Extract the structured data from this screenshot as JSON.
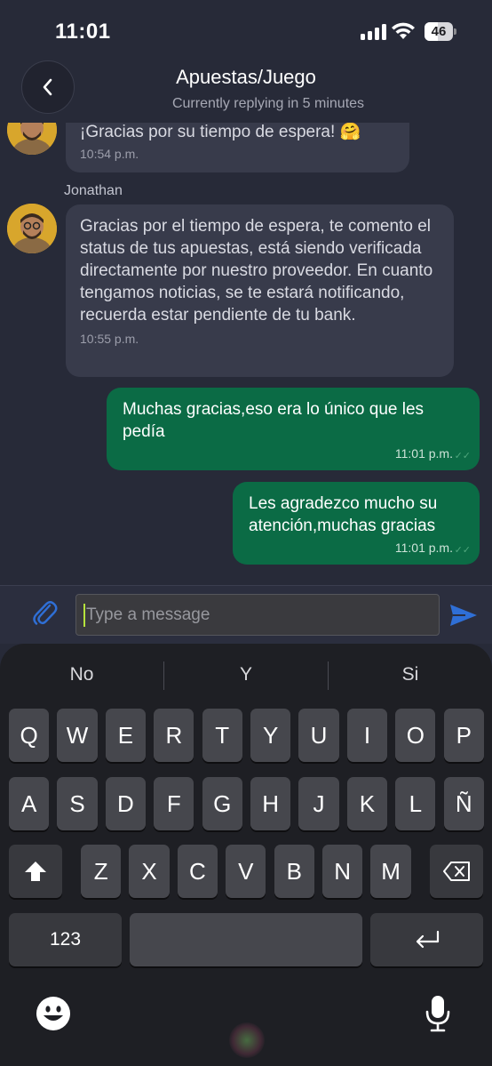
{
  "status_bar": {
    "time": "11:01",
    "battery": "46",
    "battery_level": 0.46
  },
  "header": {
    "back_icon": "chevron-left-icon",
    "title": "Apuestas/Juego",
    "subtitle": "Currently replying in 5 minutes"
  },
  "messages": [
    {
      "direction": "incoming",
      "text": "¡Gracias por su tiempo de espera! 🤗",
      "time": "10:54 p.m."
    },
    {
      "direction": "incoming",
      "sender": "Jonathan",
      "text": "Gracias por el tiempo de espera, te comento el status  de tus apuestas, está siendo verificada directamente por nuestro proveedor. En cuanto tengamos noticias, se te estará notificando, recuerda estar pendiente de tu bank.",
      "time": "10:55 p.m."
    },
    {
      "direction": "outgoing",
      "text": "Muchas gracias,eso era lo único que les pedía",
      "time": "11:01 p.m."
    },
    {
      "direction": "outgoing",
      "text": "Les agradezco mucho su atención,muchas gracias",
      "time": "11:01 p.m."
    }
  ],
  "composer": {
    "placeholder": "Type a message",
    "attach_icon": "paperclip-icon",
    "send_icon": "send-icon"
  },
  "keyboard": {
    "suggestions": [
      "No",
      "Y",
      "Si"
    ],
    "row1": [
      "Q",
      "W",
      "E",
      "R",
      "T",
      "Y",
      "U",
      "I",
      "O",
      "P"
    ],
    "row2": [
      "A",
      "S",
      "D",
      "F",
      "G",
      "H",
      "J",
      "K",
      "L",
      "Ñ"
    ],
    "row3": [
      "Z",
      "X",
      "C",
      "V",
      "B",
      "N",
      "M"
    ],
    "numbers_key": "123",
    "icons": {
      "shift": "shift-icon",
      "delete": "backspace-icon",
      "return": "return-icon",
      "emoji": "emoji-icon",
      "dictation": "microphone-icon"
    }
  },
  "colors": {
    "background": "#272a38",
    "incoming_bubble": "#383b4b",
    "outgoing_bubble": "#0b6b45",
    "accent": "#2f6fd6"
  }
}
